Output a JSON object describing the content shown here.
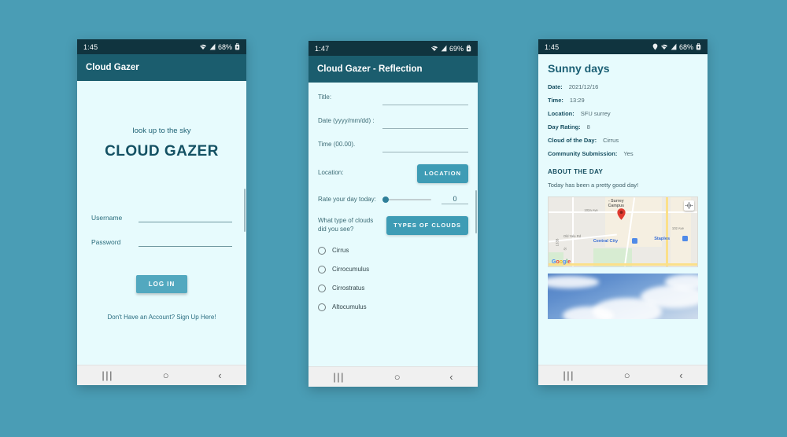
{
  "theme": {
    "page_background": "#4a9db5",
    "appbar": "#1b5d6e",
    "statusbar": "#10343f",
    "screen_background": "#e7fbfd",
    "accent_button": "#52a8bf",
    "button_teal": "#3e9cb5",
    "heading_text": "#1b5f74"
  },
  "screens": {
    "login": {
      "status": {
        "time": "1:45",
        "battery": "68%",
        "icons": [
          "wifi-icon",
          "signal-icon",
          "battery-lock-icon"
        ]
      },
      "appbar_title": "Cloud Gazer",
      "tagline": "look up to the sky",
      "brand": "CLOUD GAZER",
      "fields": [
        {
          "label": "Username",
          "value": "",
          "name": "username-field"
        },
        {
          "label": "Password",
          "value": "",
          "name": "password-field"
        }
      ],
      "login_button": "LOG IN",
      "signup_link": "Don't Have an Account? Sign Up Here!",
      "navbar": {
        "recent": "|||",
        "home": "○",
        "back": "‹"
      }
    },
    "reflection": {
      "status": {
        "time": "1:47",
        "battery": "69%",
        "icons": [
          "wifi-icon",
          "signal-icon",
          "battery-lock-icon"
        ]
      },
      "appbar_title": "Cloud Gazer - Reflection",
      "fields": [
        {
          "label": "Title:",
          "value": ""
        },
        {
          "label": "Date (yyyy/mm/dd) :",
          "value": ""
        },
        {
          "label": "Time (00.00).",
          "value": ""
        }
      ],
      "location_label": "Location:",
      "location_button": "LOCATION",
      "rating_label": "Rate your day today:",
      "rating_value": "0",
      "rating_min": 0,
      "rating_max": 10,
      "clouds_question": "What type of clouds did you see?",
      "clouds_button": "TYPES OF CLOUDS",
      "cloud_options": [
        "Cirrus",
        "Cirrocumulus",
        "Cirrostratus",
        "Altocumulus"
      ],
      "cloud_selected": "",
      "navbar": {
        "recent": "|||",
        "home": "○",
        "back": "‹"
      }
    },
    "detail": {
      "status": {
        "time": "1:45",
        "battery": "68%",
        "icons": [
          "location-pin-icon",
          "wifi-icon",
          "signal-icon",
          "battery-lock-icon"
        ]
      },
      "title": "Sunny days",
      "meta": [
        {
          "key": "Date:",
          "value": "2021/12/16"
        },
        {
          "key": "Time:",
          "value": "13:29"
        },
        {
          "key": "Location:",
          "value": "SFU surrey"
        },
        {
          "key": "Day Rating:",
          "value": "8"
        },
        {
          "key": "Cloud of the Day:",
          "value": "Cirrus"
        },
        {
          "key": "Community Submission:",
          "value": "Yes"
        }
      ],
      "about_heading": "ABOUT THE DAY",
      "about_text": "Today has been a pretty good day!",
      "map": {
        "provider": "Google",
        "campus_label": "- Surrey\nCampus",
        "pois": [
          {
            "name": "Central City"
          },
          {
            "name": "Staples"
          }
        ],
        "streets": [
          "102a Ave",
          "Old Yale Rd",
          "102 Ave",
          "133B",
          "St"
        ]
      },
      "photo_alt": "sky-photo",
      "navbar": {
        "recent": "|||",
        "home": "○",
        "back": "‹"
      }
    }
  }
}
